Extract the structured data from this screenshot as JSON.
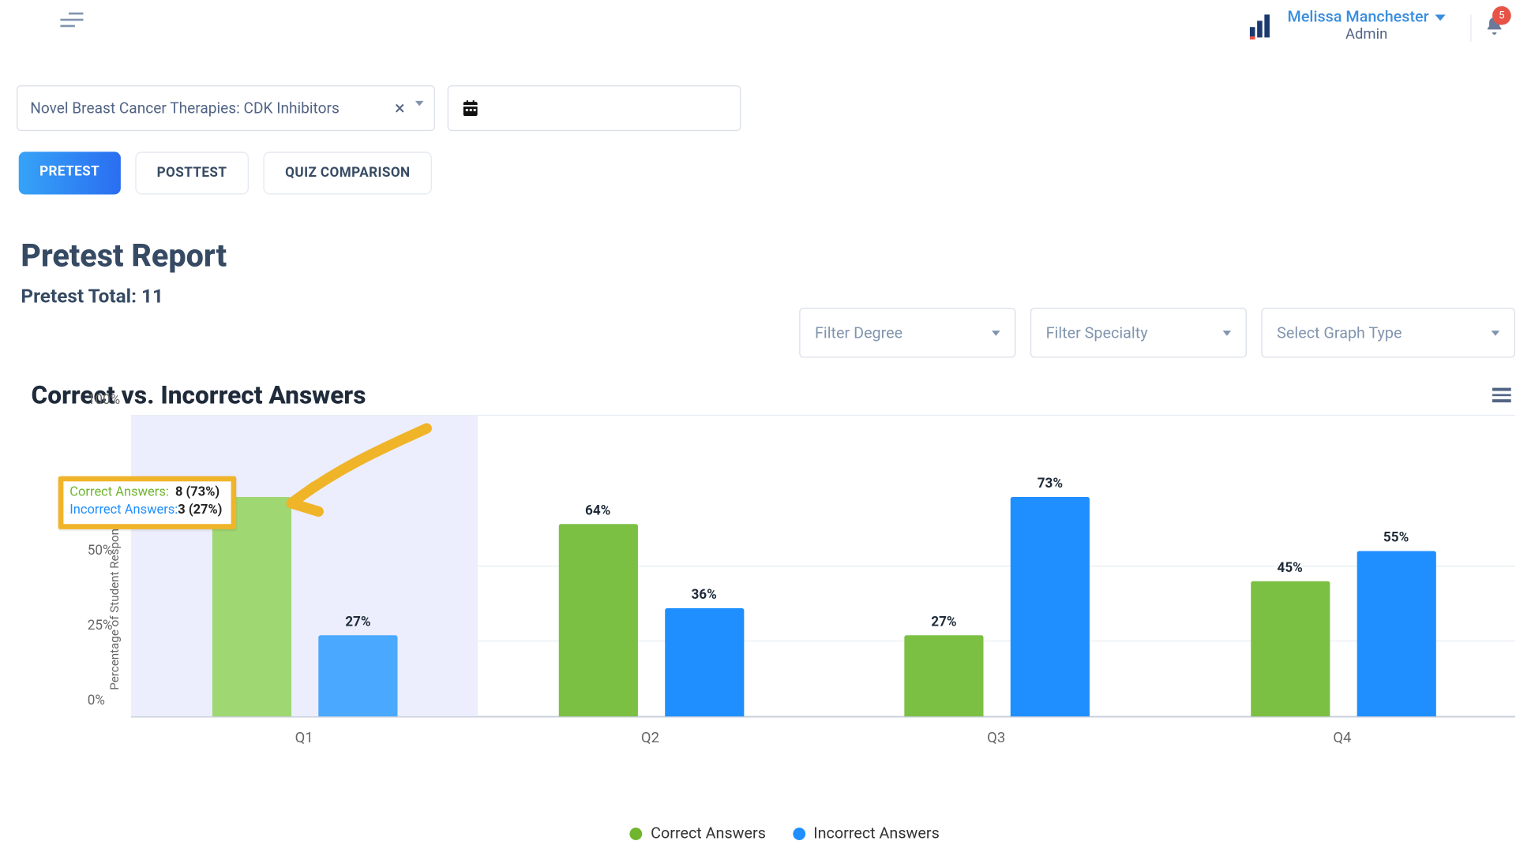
{
  "header": {
    "user_name": "Melissa Manchester",
    "user_role": "Admin",
    "notif_count": "5"
  },
  "controls": {
    "course": "Novel Breast Cancer Therapies: CDK Inhibitors"
  },
  "tabs": {
    "pretest": "PRETEST",
    "posttest": "POSTTEST",
    "quiz_comparison": "QUIZ COMPARISON"
  },
  "report": {
    "title": "Pretest Report",
    "subtitle": "Pretest Total: 11"
  },
  "filters": {
    "degree": "Filter Degree",
    "specialty": "Filter Specialty",
    "graph_type": "Select Graph Type"
  },
  "chart": {
    "title": "Correct vs. Incorrect Answers",
    "ylabel": "Percentage of Student Response",
    "legend_correct": "Correct Answers",
    "legend_incorrect": "Incorrect Answers",
    "yticks": {
      "t0": "0%",
      "t25": "25%",
      "t50": "50%",
      "t100": "100%"
    },
    "xticks": {
      "q1": "Q1",
      "q2": "Q2",
      "q3": "Q3",
      "q4": "Q4"
    },
    "labels": {
      "q1_i": "27%",
      "q2_c": "64%",
      "q2_i": "36%",
      "q3_c": "27%",
      "q3_i": "73%",
      "q4_c": "45%",
      "q4_i": "55%"
    },
    "tooltip": {
      "correct_label": "Correct Answers:",
      "correct_value": "8 (73%)",
      "incorrect_label": "Incorrect Answers:",
      "incorrect_value": "3 (27%)"
    }
  },
  "chart_data": {
    "type": "bar",
    "title": "Correct vs. Incorrect Answers",
    "xlabel": "",
    "ylabel": "Percentage of Student Response",
    "ylim": [
      0,
      100
    ],
    "categories": [
      "Q1",
      "Q2",
      "Q3",
      "Q4"
    ],
    "series": [
      {
        "name": "Correct Answers",
        "values": [
          73,
          64,
          27,
          45
        ],
        "color": "#7bc043"
      },
      {
        "name": "Incorrect Answers",
        "values": [
          27,
          36,
          73,
          55
        ],
        "color": "#1f8fff"
      }
    ],
    "counts": {
      "Q1": {
        "correct": 8,
        "incorrect": 3,
        "total": 11
      }
    }
  }
}
